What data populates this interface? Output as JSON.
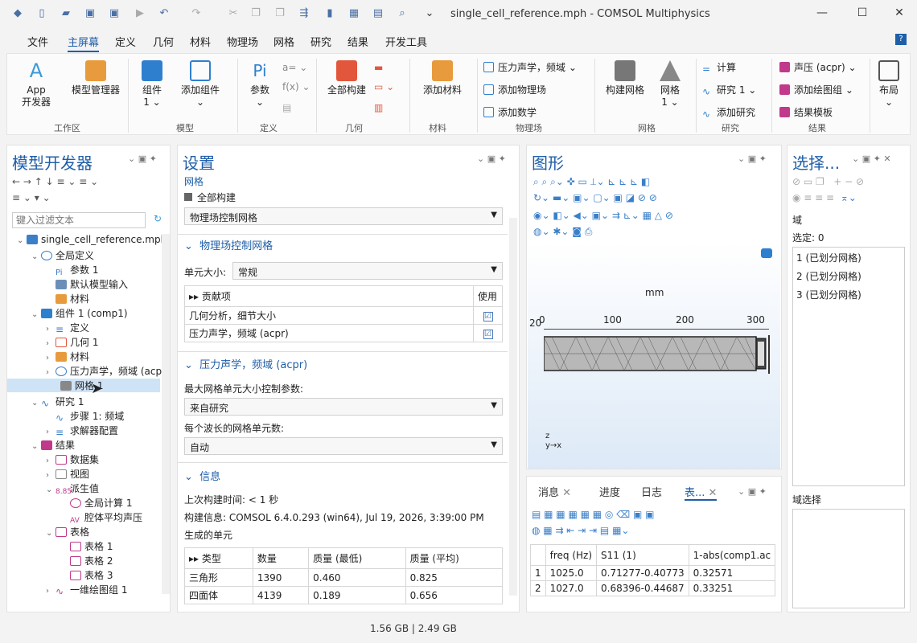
{
  "window": {
    "title": "single_cell_reference.mph - COMSOL Multiphysics"
  },
  "menu": [
    "文件",
    "主屏幕",
    "定义",
    "几何",
    "材料",
    "物理场",
    "网格",
    "研究",
    "结果",
    "开发工具"
  ],
  "ribbon": {
    "workspace": {
      "app": "App\n开发器",
      "model_manager": "模型管理器",
      "label": "工作区"
    },
    "model": {
      "component": "组件\n1 ⌄",
      "add_component": "添加组件\n⌄",
      "label": "模型"
    },
    "definitions": {
      "parameters": "参数\n⌄",
      "label": "定义"
    },
    "geometry": {
      "build_all": "全部构建",
      "label": "几何"
    },
    "materials": {
      "add_material": "添加材料",
      "label": "材料"
    },
    "physics": {
      "physics_select": "压力声学，频域 ⌄",
      "add_physics": "添加物理场",
      "add_math": "添加数学",
      "label": "物理场"
    },
    "mesh": {
      "build_mesh": "构建网格",
      "mesh1": "网格\n1 ⌄",
      "label": "网格"
    },
    "study": {
      "compute": "计算",
      "study1": "研究 1 ⌄",
      "add_study": "添加研究",
      "label": "研究"
    },
    "results": {
      "acpr": "声压 (acpr) ⌄",
      "add_plot": "添加绘图组 ⌄",
      "report": "结果模板",
      "label": "结果"
    },
    "layout": {
      "layout": "布局\n⌄"
    }
  },
  "model_builder": {
    "title": "模型开发器",
    "filter_placeholder": "键入过滤文本",
    "tree": [
      "single_cell_reference.mph",
      "全局定义",
      "参数 1",
      "默认模型输入",
      "材料",
      "组件 1 (comp1)",
      "定义",
      "几何 1",
      "材料",
      "压力声学，频域 (acpr)",
      "网格 1",
      "研究 1",
      "步骤 1: 频域",
      "求解器配置",
      "结果",
      "数据集",
      "视图",
      "派生值",
      "全局计算 1",
      "腔体平均声压",
      "表格",
      "表格 1",
      "表格 2",
      "表格 3",
      "一维绘图组 1"
    ]
  },
  "settings": {
    "title": "设置",
    "subtitle": "网格",
    "build_all": "全部构建",
    "sequence_type": "物理场控制网格",
    "sec1": "物理场控制网格",
    "element_size_label": "单元大小:",
    "element_size": "常规",
    "contrib_col": "贡献项",
    "use_col": "使用",
    "contribs": [
      {
        "name": "几何分析，细节大小",
        "use": "☑"
      },
      {
        "name": "压力声学，频域 (acpr)",
        "use": "☑"
      }
    ],
    "sec2": "压力声学，频域 (acpr)",
    "max_elem_label": "最大网格单元大小控制参数:",
    "max_elem_value": "来自研究",
    "per_wave_label": "每个波长的网格单元数:",
    "per_wave_value": "自动",
    "sec3": "信息",
    "last_build": "上次构建时间:  < 1 秒",
    "build_info": "构建信息:  COMSOL 6.4.0.293 (win64), Jul 19, 2026, 3:39:00 PM",
    "generated": "生成的单元",
    "table_headers": [
      "类型",
      "数量",
      "质量 (最低)",
      "质量 (平均)"
    ],
    "table_rows": [
      [
        "三角形",
        "1390",
        "0.460",
        "0.825"
      ],
      [
        "四面体",
        "4139",
        "0.189",
        "0.656"
      ]
    ]
  },
  "graphics": {
    "title": "图形",
    "unit": "mm",
    "ticks": [
      "0",
      "100",
      "200",
      "300"
    ],
    "y_tick": "20",
    "axis_z": "z",
    "axis_yx": "y→x"
  },
  "bottom": {
    "tabs": [
      "消息",
      "进度",
      "日志",
      "表..."
    ],
    "headers": [
      "",
      "freq (Hz)",
      "S11 (1)",
      "1-abs(comp1.ac"
    ],
    "rows": [
      [
        "1",
        "1025.0",
        "0.71277-0.40773",
        "0.32571"
      ],
      [
        "2",
        "1027.0",
        "0.68396-0.44687",
        "0.33251"
      ]
    ]
  },
  "selection": {
    "title": "选择...",
    "domain": "域",
    "selected": "选定: 0",
    "items": [
      "1 (已划分网格)",
      "2 (已划分网格)",
      "3 (已划分网格)"
    ],
    "domain_select": "域选择"
  },
  "status": {
    "memory": "1.56 GB | 2.49 GB"
  },
  "colors": {
    "accent": "#1f5ea8",
    "selection": "#cfe3f7"
  }
}
